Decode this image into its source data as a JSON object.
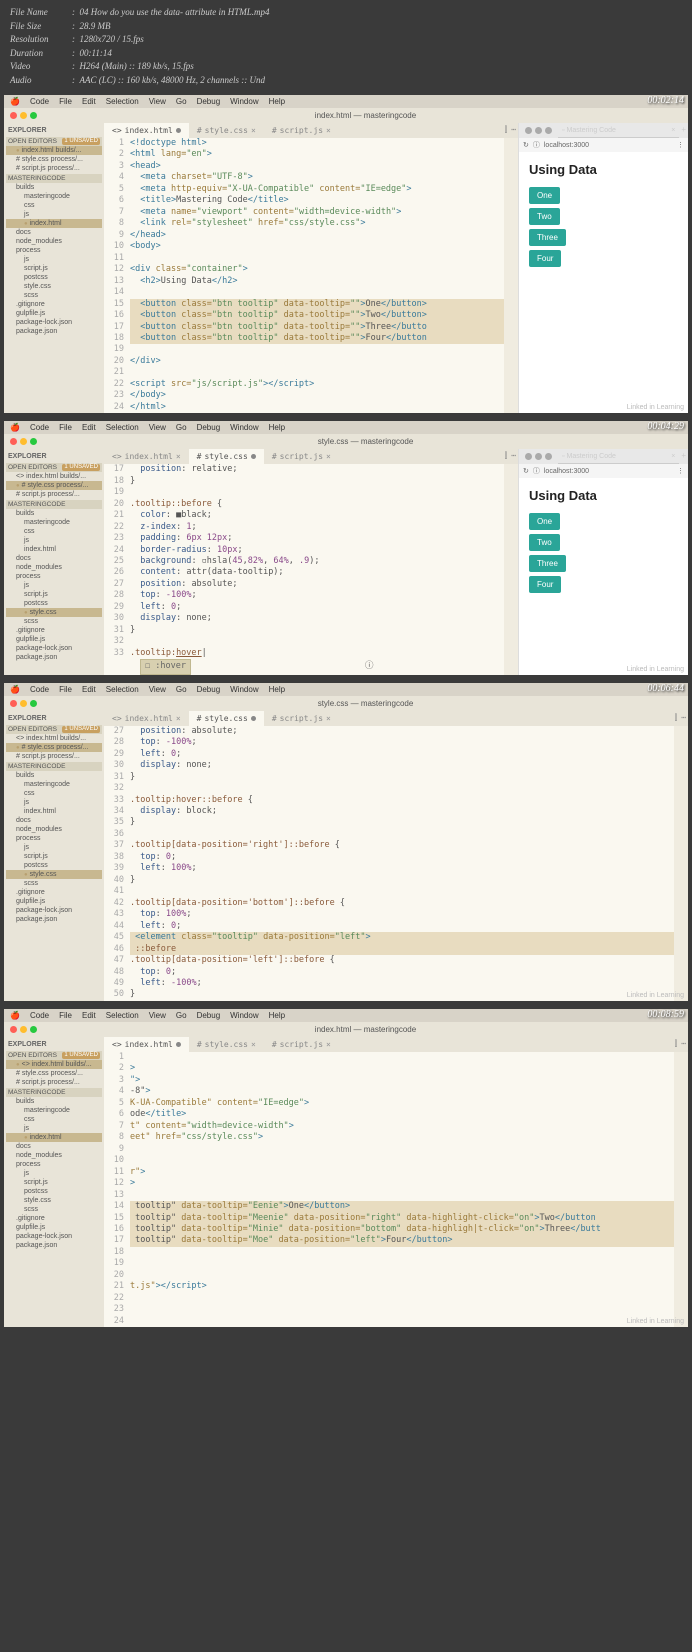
{
  "fileinfo": {
    "name_label": "File Name",
    "name": "04 How do you use the data- attribute in HTML.mp4",
    "size_label": "File Size",
    "size": "28.9 MB",
    "res_label": "Resolution",
    "res": "1280x720 / 15.fps",
    "dur_label": "Duration",
    "dur": "00:11:14",
    "vid_label": "Video",
    "vid": "H264 (Main) :: 189 kb/s, 15.fps",
    "aud_label": "Audio",
    "aud": "AAC (LC) :: 160 kb/s, 48000 Hz, 2 channels :: Und"
  },
  "menubar": [
    "Code",
    "File",
    "Edit",
    "Selection",
    "View",
    "Go",
    "Debug",
    "Window",
    "Help"
  ],
  "sidebar": {
    "title": "EXPLORER",
    "open_editors": "OPEN EDITORS",
    "unsaved": "1 UNSAVED",
    "project": "MASTERINGCODE",
    "files_common": [
      "builds",
      "masteringcode",
      "css",
      "js",
      "index.html",
      "docs",
      "node_modules",
      "process",
      "js",
      "script.js",
      "postcss",
      "style.css",
      "scss",
      ".gitignore",
      "gulpfile.js",
      "package-lock.json",
      "package.json"
    ],
    "open_items": {
      "index_html": "index.html",
      "style_css": "style.css",
      "script_js": "script.js",
      "builds_suffix": "builds/...",
      "process_suffix": "process/..."
    }
  },
  "tabs": {
    "index": "index.html",
    "style": "style.css",
    "script": "script.js"
  },
  "browser": {
    "tab": "Mastering Code",
    "url": "localhost:3000",
    "heading": "Using Data",
    "buttons": [
      "One",
      "Two",
      "Three",
      "Four"
    ]
  },
  "watermark": "Linked in Learning",
  "panel1": {
    "timestamp": "00:02:14",
    "window_title": "index.html — masteringcode",
    "gutter": [
      "1",
      "2",
      "3",
      "4",
      "5",
      "6",
      "7",
      "8",
      "9",
      "10",
      "11",
      "12",
      "13",
      "14",
      "15",
      "16",
      "17",
      "18",
      "19",
      "20",
      "21",
      "22",
      "23",
      "24"
    ]
  },
  "panel2": {
    "timestamp": "00:04:29",
    "window_title": "style.css — masteringcode",
    "gutter": [
      "17",
      "18",
      "19",
      "20",
      "21",
      "22",
      "23",
      "24",
      "25",
      "26",
      "27",
      "28",
      "29",
      "30",
      "31",
      "32",
      "33"
    ],
    "suggest": "☐ :hover"
  },
  "panel3": {
    "timestamp": "00:06:44",
    "window_title": "style.css — masteringcode",
    "gutter": [
      "27",
      "28",
      "29",
      "30",
      "31",
      "32",
      "33",
      "34",
      "35",
      "36",
      "37",
      "38",
      "39",
      "40",
      "41",
      "42",
      "43",
      "44",
      "45",
      "46",
      "47",
      "48",
      "49",
      "50"
    ]
  },
  "panel4": {
    "timestamp": "00:08:59",
    "window_title": "index.html — masteringcode",
    "gutter": [
      "1",
      "2",
      "3",
      "4",
      "5",
      "6",
      "7",
      "8",
      "9",
      "10",
      "11",
      "12",
      "13",
      "14",
      "15",
      "16",
      "17",
      "18",
      "19",
      "20",
      "21",
      "22",
      "23",
      "24"
    ]
  }
}
